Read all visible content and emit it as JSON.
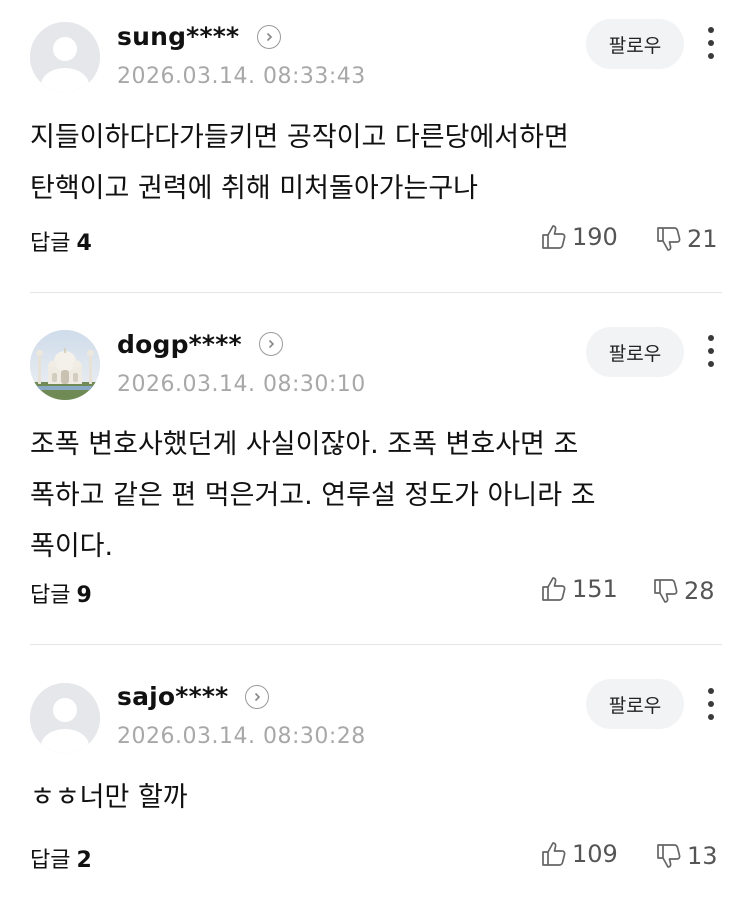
{
  "follow_label": "팔로우",
  "reply_label": "답글",
  "comments": [
    {
      "username": "sung****",
      "timestamp": "2026.03.14. 08:33:43",
      "text": "지들이하다다가들키면 공작이고 다른당에서하면\n탄핵이고 권력에 취해 미처돌아가는구나",
      "reply_count": "4",
      "likes": "190",
      "dislikes": "21",
      "avatar": "default-avatar"
    },
    {
      "username": "dogp****",
      "timestamp": "2026.03.14. 08:30:10",
      "text": "조폭 변호사했던게 사실이잖아. 조폭 변호사면 조\n폭하고 같은 편 먹은거고. 연루설 정도가 아니라 조\n폭이다.",
      "reply_count": "9",
      "likes": "151",
      "dislikes": "28",
      "avatar": "taj-mahal-photo"
    },
    {
      "username": "sajo****",
      "timestamp": "2026.03.14. 08:30:28",
      "text": "ㅎㅎ너만 할까",
      "reply_count": "2",
      "likes": "109",
      "dislikes": "13",
      "avatar": "default-avatar"
    }
  ]
}
